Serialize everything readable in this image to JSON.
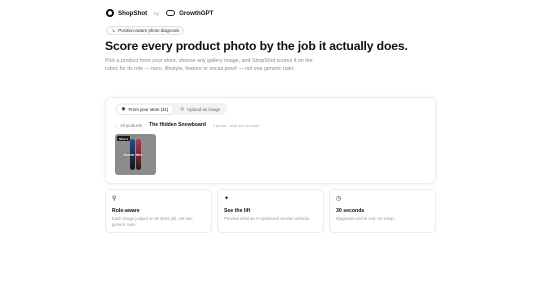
{
  "brand": {
    "name": "ShopShot",
    "by": "by",
    "partner": "GrowthGPT"
  },
  "pill": {
    "icon": "sparkle-icon",
    "text": "Position-aware photo diagnosis"
  },
  "hero": {
    "title": "Score every product photo by the job it actually does.",
    "subtitle": "Pick a product from your store, choose any gallery image, and ShopShot scores it on the rubric for its role — hero, lifestyle, feature or social proof — not one generic ruler."
  },
  "picker": {
    "tabs": [
      {
        "label": "From your store (11)",
        "icon": "store-icon",
        "active": true
      },
      {
        "label": "Upload an image",
        "icon": "upload-icon",
        "active": false
      }
    ],
    "back_label": "← All products",
    "product_title": "The Hidden Snowboard",
    "meta": "1 photo · click one to score",
    "thumbnails": [
      {
        "badge": "Shot 1",
        "cta": "Score this →"
      }
    ]
  },
  "features": [
    {
      "icon": "search-icon",
      "title": "Role-aware",
      "desc": "Each image judged on its slot's job, not one generic ruler."
    },
    {
      "icon": "wand-icon",
      "title": "See the lift",
      "desc": "Preview what an AI-optimized version unlocks."
    },
    {
      "icon": "clock-icon",
      "title": "30 seconds",
      "desc": "Diagnosis end to end, no setup."
    }
  ]
}
